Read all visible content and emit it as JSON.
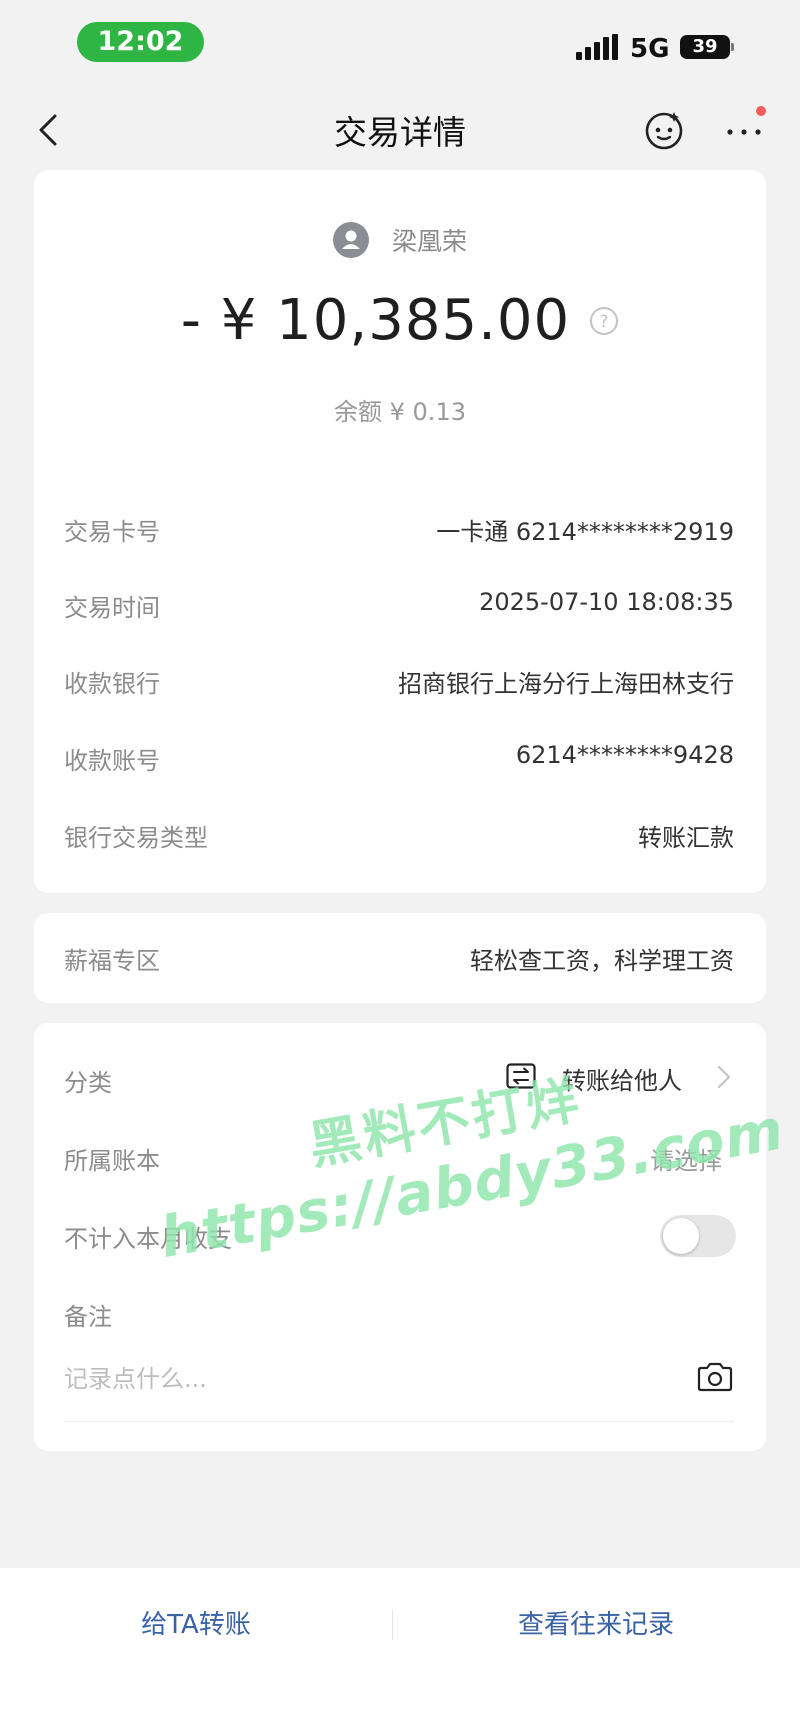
{
  "status_bar": {
    "time": "12:02",
    "network": "5G",
    "battery": "39"
  },
  "nav": {
    "title": "交易详情"
  },
  "transaction": {
    "payee_name": "梁凰荣",
    "amount": "- ¥ 10,385.00",
    "balance": "余额 ¥ 0.13"
  },
  "details": [
    {
      "label": "交易卡号",
      "value": "一卡通 6214********2919"
    },
    {
      "label": "交易时间",
      "value": "2025-07-10 18:08:35"
    },
    {
      "label": "收款银行",
      "value": "招商银行上海分行上海田林支行"
    },
    {
      "label": "收款账号",
      "value": "6214********9428"
    },
    {
      "label": "银行交易类型",
      "value": "转账汇款"
    }
  ],
  "salary_zone": {
    "label": "薪福专区",
    "value": "轻松查工资，科学理工资"
  },
  "meta": {
    "category_label": "分类",
    "category_value": "转账给他人",
    "ledger_label": "所属账本",
    "ledger_placeholder": "请选择",
    "exclude_label": "不计入本月收支",
    "exclude_enabled": false,
    "note_label": "备注",
    "note_placeholder": "记录点什么..."
  },
  "watermark": {
    "line1": "黑料不打烊",
    "line2": "https://abdy33.com"
  },
  "bottom_bar": {
    "transfer_label": "给TA转账",
    "history_label": "查看往来记录"
  },
  "colors": {
    "accent_link": "#3a63a6",
    "time_pill": "#2fb544",
    "watermark": "#8fe6ad"
  }
}
